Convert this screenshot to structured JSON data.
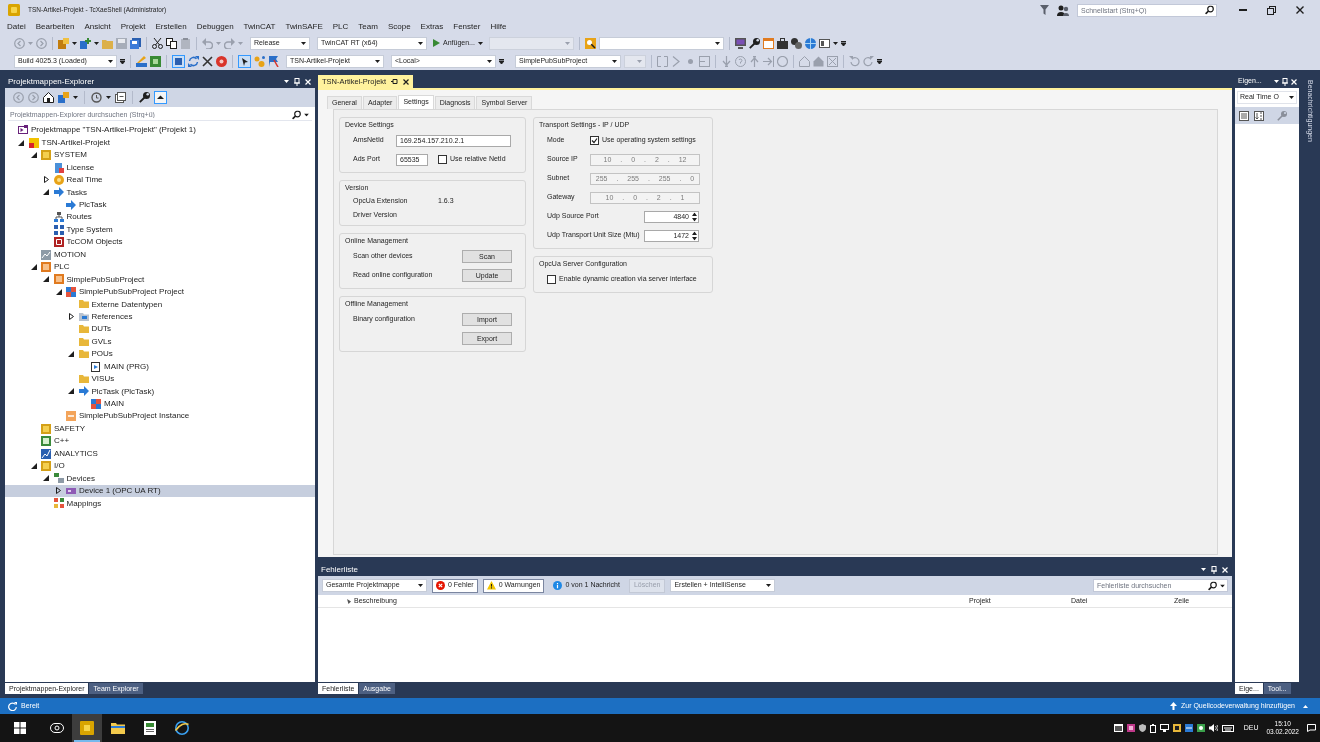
{
  "window": {
    "title": "TSN-Artikel-Projekt - TcXaeShell (Administrator)",
    "quick_launch": {
      "placeholder": "Schnellstart (Strg+Q)"
    }
  },
  "menu": [
    "Datei",
    "Bearbeiten",
    "Ansicht",
    "Projekt",
    "Erstellen",
    "Debuggen",
    "TwinCAT",
    "TwinSAFE",
    "PLC",
    "Team",
    "Scope",
    "Extras",
    "Fenster",
    "Hilfe"
  ],
  "toolbar": {
    "configuration": "Release",
    "platform": "TwinCAT RT (x64)",
    "attach_button": "Anfügen...",
    "build": "Build 4025.3 (Loaded)",
    "target_project": "TSN-Artikel-Projekt",
    "target_system": "<Local>",
    "plc_project": "SimplePubSubProject"
  },
  "solution_explorer": {
    "title": "Projektmappen-Explorer",
    "search": {
      "placeholder": "Projektmappen-Explorer durchsuchen (Strg+ü)"
    },
    "tree": [
      {
        "label": "Projektmappe \"TSN-Artikel-Projekt\" (Projekt 1)",
        "kind": "solution",
        "selected": false,
        "children": [
          {
            "label": "TSN-Artikel-Projekt",
            "kind": "project",
            "expanded": true,
            "selected": false,
            "children": [
              {
                "label": "SYSTEM",
                "kind": "module",
                "expanded": true,
                "selected": false,
                "children": [
                  {
                    "label": "License",
                    "kind": "license",
                    "selected": false
                  },
                  {
                    "label": "Real Time",
                    "kind": "realtime",
                    "expanded": false,
                    "selected": false
                  },
                  {
                    "label": "Tasks",
                    "kind": "task",
                    "expanded": true,
                    "selected": false,
                    "children": [
                      {
                        "label": "PlcTask",
                        "kind": "task",
                        "selected": false
                      }
                    ]
                  },
                  {
                    "label": "Routes",
                    "kind": "routes",
                    "selected": false
                  },
                  {
                    "label": "Type System",
                    "kind": "types",
                    "selected": false
                  },
                  {
                    "label": "TcCOM Objects",
                    "kind": "tccom",
                    "selected": false
                  }
                ]
              },
              {
                "label": "MOTION",
                "kind": "motion",
                "selected": false
              },
              {
                "label": "PLC",
                "kind": "plc",
                "expanded": true,
                "selected": false,
                "children": [
                  {
                    "label": "SimplePubSubProject",
                    "kind": "plc",
                    "expanded": true,
                    "selected": false,
                    "children": [
                      {
                        "label": "SimplePubSubProject Project",
                        "kind": "plcproject",
                        "expanded": true,
                        "selected": false,
                        "children": [
                          {
                            "label": "Externe Datentypen",
                            "kind": "folder",
                            "selected": false
                          },
                          {
                            "label": "References",
                            "kind": "references",
                            "expanded": false,
                            "selected": false
                          },
                          {
                            "label": "DUTs",
                            "kind": "folder",
                            "selected": false
                          },
                          {
                            "label": "GVLs",
                            "kind": "folder",
                            "selected": false
                          },
                          {
                            "label": "POUs",
                            "kind": "folder",
                            "expanded": true,
                            "selected": false,
                            "children": [
                              {
                                "label": "MAIN (PRG)",
                                "kind": "program",
                                "selected": false
                              }
                            ]
                          },
                          {
                            "label": "VISUs",
                            "kind": "folder",
                            "selected": false
                          },
                          {
                            "label": "PlcTask (PlcTask)",
                            "kind": "task",
                            "expanded": true,
                            "selected": false,
                            "children": [
                              {
                                "label": "MAIN",
                                "kind": "plcproject",
                                "selected": false
                              }
                            ]
                          }
                        ]
                      },
                      {
                        "label": "SimplePubSubProject Instance",
                        "kind": "instance",
                        "selected": false
                      }
                    ]
                  }
                ]
              },
              {
                "label": "SAFETY",
                "kind": "module",
                "selected": false
              },
              {
                "label": "C++",
                "kind": "cpp",
                "selected": false
              },
              {
                "label": "ANALYTICS",
                "kind": "analytics",
                "selected": false
              },
              {
                "label": "I/O",
                "kind": "module",
                "expanded": true,
                "selected": false,
                "children": [
                  {
                    "label": "Devices",
                    "kind": "devices",
                    "expanded": true,
                    "selected": false,
                    "children": [
                      {
                        "label": "Device 1 (OPC UA RT)",
                        "kind": "device",
                        "expanded": false,
                        "selected": true
                      }
                    ]
                  },
                  {
                    "label": "Mappings",
                    "kind": "mappings",
                    "selected": false
                  }
                ]
              }
            ]
          }
        ]
      }
    ],
    "tabs": [
      {
        "label": "Projektmappen-Explorer",
        "selected": true
      },
      {
        "label": "Team Explorer",
        "selected": false
      }
    ]
  },
  "document": {
    "tab": "TSN-Artikel-Projekt",
    "tabs": [
      {
        "label": "General",
        "selected": false
      },
      {
        "label": "Adapter",
        "selected": false
      },
      {
        "label": "Settings",
        "selected": true
      },
      {
        "label": "Diagnosis",
        "selected": false
      },
      {
        "label": "Symbol Server",
        "selected": false
      }
    ],
    "left_groups": [
      {
        "title": "Device Settings",
        "rows": [
          {
            "kind": "field",
            "label": "AmsNetId",
            "value": "169.254.157.210.2.1"
          },
          {
            "kind": "port",
            "label": "Ads Port",
            "value": "65535",
            "checkbox": {
              "label": "Use relative NetId",
              "checked": false
            }
          }
        ]
      },
      {
        "title": "Version",
        "rows": [
          {
            "kind": "text",
            "label": "OpcUa Extension",
            "value": "1.6.3"
          },
          {
            "kind": "text",
            "label": "Driver Version"
          }
        ]
      },
      {
        "title": "Online Management",
        "rows": [
          {
            "kind": "button",
            "label": "Scan other devices",
            "button": "Scan"
          },
          {
            "kind": "button",
            "label": "Read online configuration",
            "button": "Update"
          }
        ]
      },
      {
        "title": "Offline Management",
        "rows": [
          {
            "kind": "button",
            "label": "Binary configuration",
            "button": "Import"
          },
          {
            "kind": "button",
            "button": "Export"
          }
        ]
      }
    ],
    "right_groups": [
      {
        "title": "Transport Settings - IP / UDP",
        "rows": [
          {
            "kind": "checkbox",
            "label": "Mode",
            "checkbox": {
              "label": "Use operating system settings",
              "checked": true
            }
          },
          {
            "kind": "ip",
            "label": "Source IP",
            "value": "10 . 0 . 2 . 12",
            "disabled": true
          },
          {
            "kind": "ip",
            "label": "Subnet",
            "value": "255 . 255 . 255 . 0",
            "disabled": true
          },
          {
            "kind": "ip",
            "label": "Gateway",
            "value": "10 . 0 . 2 . 1",
            "disabled": true
          },
          {
            "kind": "spinner",
            "label": "Udp Source Port",
            "value": "4840"
          },
          {
            "kind": "spinner",
            "label": "Udp Transport Unit Size (Mtu)",
            "value": "1472"
          }
        ]
      },
      {
        "title": "OpcUa Server Configuration",
        "rows": [
          {
            "kind": "checkbox",
            "checkbox": {
              "label": "Enable dynamic creation via server interface",
              "checked": false
            }
          }
        ]
      }
    ]
  },
  "error_list": {
    "title": "Fehlerliste",
    "scope": "Gesamte Projektmappe",
    "filters": [
      {
        "kind": "error",
        "label": "0 Fehler",
        "selected": true
      },
      {
        "kind": "warning",
        "label": "0 Warnungen",
        "selected": true
      },
      {
        "kind": "message",
        "label": "0 von 1 Nachricht",
        "selected": false
      }
    ],
    "clear_button": {
      "label": "Löschen",
      "disabled": true
    },
    "source": "Erstellen + IntelliSense",
    "search": {
      "placeholder": "Fehlerliste durchsuchen"
    },
    "columns": [
      "Beschreibung",
      "Projekt",
      "Datei",
      "Zeile"
    ],
    "tabs": [
      {
        "label": "Fehlerliste",
        "selected": true
      },
      {
        "label": "Ausgabe",
        "selected": false
      }
    ]
  },
  "properties": {
    "title": "Eigen...",
    "object": "Real Time O",
    "tabs": [
      {
        "label": "Eige...",
        "selected": true
      },
      {
        "label": "Tool...",
        "selected": false
      }
    ]
  },
  "side_tabs": [
    "Benachrichtigungen"
  ],
  "status_bar": {
    "text": "Bereit",
    "source_control": "Zur Quellcodeverwaltung hinzufügen"
  },
  "taskbar": {
    "apps": [
      {
        "kind": "twincat",
        "selected": true
      },
      {
        "kind": "explorer",
        "selected": false
      },
      {
        "kind": "editor",
        "selected": false
      },
      {
        "kind": "browser",
        "selected": false
      }
    ],
    "language": "DEU",
    "time": "15:10",
    "date": "03.02.2022"
  }
}
